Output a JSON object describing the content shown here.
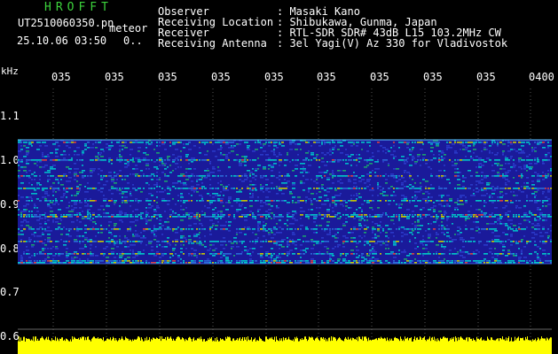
{
  "header": {
    "brand": "HROFFT",
    "filename": "UT2510060350.pn",
    "mode": "meteor",
    "datetime": "25.10.06 03:50",
    "count": "0.."
  },
  "info": {
    "rows": [
      {
        "label": "Observer",
        "value": ": Masaki Kano"
      },
      {
        "label": "Receiving Location",
        "value": ": Shibukawa, Gunma, Japan"
      },
      {
        "label": "Receiver",
        "value": ": RTL-SDR SDR# 43dB L15 103.2MHz CW"
      },
      {
        "label": "Receiving Antenna",
        "value": ": 3el Yagi(V) Az 330 for Vladivostok"
      }
    ]
  },
  "axis": {
    "unit": "kHz",
    "x_ticks": [
      "035",
      "035",
      "035",
      "035",
      "035",
      "035",
      "035",
      "035",
      "035",
      "0400"
    ],
    "y_ticks": [
      "1.1",
      "1.0",
      "0.9",
      "0.8",
      "0.7",
      "0.6"
    ]
  },
  "colors": {
    "background": "#000000",
    "brand": "#3cd23c",
    "noise_floor": "#1a1a9a",
    "strong": "#00d8d8",
    "signal_bar": "#ffff00"
  }
}
